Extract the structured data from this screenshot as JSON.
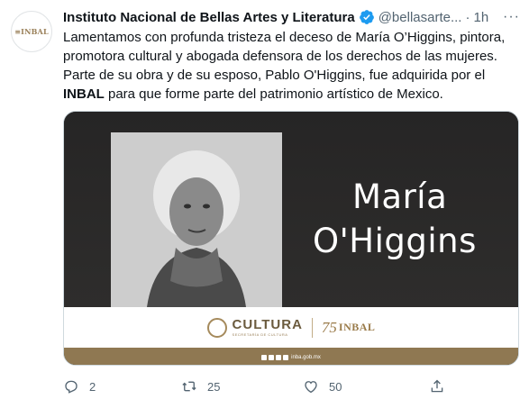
{
  "tweet": {
    "avatar_text": "≡INBAL",
    "author_name": "Instituto Nacional de Bellas Artes y Literatura",
    "handle": "@bellasarte...",
    "separator": "·",
    "time": "1h",
    "more_glyph": "···",
    "text": {
      "line1": "Lamentamos con profunda tristeza el deceso de María O’Higgins, pintora,",
      "line2": "promotora cultural y abogada defensora de los derechos de las mujeres.",
      "line3": "Parte de su obra y de su esposo, Pablo O'Higgins, fue adquirida por el",
      "line4_bold": "INBAL",
      "line4_rest": " para que forme parte del patrimonio artístico de Mexico."
    }
  },
  "media": {
    "name_line1": "María",
    "name_line2": "O'Higgins",
    "cultura": "CULTURA",
    "cultura_sub": "SECRETARÍA DE CULTURA",
    "inbal_75": "75",
    "inbal": "INBAL",
    "footer_url": "inba.gob.mx"
  },
  "actions": {
    "replies": "2",
    "retweets": "25",
    "likes": "50"
  },
  "colors": {
    "verified": "#1d9bf0",
    "secondary_text": "#536471",
    "gold": "#8f7852"
  }
}
